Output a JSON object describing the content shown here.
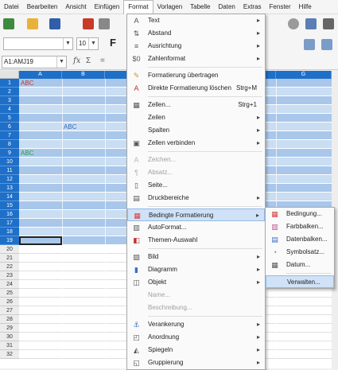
{
  "menubar": [
    "Datei",
    "Bearbeiten",
    "Ansicht",
    "Einfügen",
    "Format",
    "Vorlagen",
    "Tabelle",
    "Daten",
    "Extras",
    "Fenster",
    "Hilfe"
  ],
  "toolbar": {
    "font_size": "10",
    "name_box": "A1:AMJ19",
    "fx": "fx",
    "sigma": "Σ",
    "equals": "=",
    "big_f": "F"
  },
  "columns": [
    "A",
    "B",
    "G"
  ],
  "cells": {
    "a1": "ABC",
    "b6": "ABC",
    "a9": "ABC"
  },
  "rows": [
    "1",
    "2",
    "3",
    "4",
    "5",
    "6",
    "7",
    "8",
    "9",
    "10",
    "11",
    "12",
    "13",
    "14",
    "15",
    "16",
    "17",
    "18",
    "19",
    "20",
    "21",
    "22",
    "23",
    "24",
    "25",
    "26",
    "27",
    "28",
    "29",
    "30",
    "31",
    "32"
  ],
  "format_menu": [
    {
      "label": "Text",
      "icon": "text-icon",
      "sub": true
    },
    {
      "label": "Abstand",
      "icon": "spacing-icon",
      "sub": true
    },
    {
      "label": "Ausrichtung",
      "icon": "align-icon",
      "sub": true
    },
    {
      "label": "Zahlenformat",
      "icon": "number-format-icon",
      "sub": true
    },
    {
      "sep": true
    },
    {
      "label": "Formatierung übertragen",
      "icon": "paintbrush-icon"
    },
    {
      "label": "Direkte Formatierung löschen",
      "icon": "clear-format-icon",
      "shortcut": "Strg+M"
    },
    {
      "sep": true
    },
    {
      "label": "Zellen...",
      "icon": "cells-icon",
      "shortcut": "Strg+1"
    },
    {
      "label": "Zeilen",
      "sub": true
    },
    {
      "label": "Spalten",
      "sub": true
    },
    {
      "label": "Zellen verbinden",
      "icon": "merge-icon",
      "sub": true
    },
    {
      "sep": true
    },
    {
      "label": "Zeichen...",
      "icon": "character-icon",
      "disabled": true
    },
    {
      "label": "Absatz...",
      "icon": "paragraph-icon",
      "disabled": true
    },
    {
      "label": "Seite...",
      "icon": "page-icon"
    },
    {
      "label": "Druckbereiche",
      "icon": "print-range-icon",
      "sub": true
    },
    {
      "sep": true
    },
    {
      "label": "Bedingte Formatierung",
      "icon": "conditional-format-icon",
      "sub": true,
      "highlighted": true
    },
    {
      "label": "AutoFormat...",
      "icon": "autoformat-icon"
    },
    {
      "label": "Themen-Auswahl",
      "icon": "theme-icon"
    },
    {
      "sep": true
    },
    {
      "label": "Bild",
      "icon": "image-icon",
      "sub": true
    },
    {
      "label": "Diagramm",
      "icon": "chart-icon",
      "sub": true
    },
    {
      "label": "Objekt",
      "icon": "object-icon",
      "sub": true
    },
    {
      "label": "Name...",
      "disabled": true
    },
    {
      "label": "Beschreibung...",
      "disabled": true
    },
    {
      "sep": true
    },
    {
      "label": "Verankerung",
      "icon": "anchor-icon",
      "sub": true
    },
    {
      "label": "Anordnung",
      "icon": "arrange-icon",
      "sub": true
    },
    {
      "label": "Spiegeln",
      "icon": "flip-icon",
      "sub": true
    },
    {
      "label": "Gruppierung",
      "icon": "group-icon",
      "sub": true
    }
  ],
  "cond_submenu": [
    {
      "label": "Bedingung...",
      "icon": "condition-icon"
    },
    {
      "label": "Farbbalken...",
      "icon": "color-scale-icon"
    },
    {
      "label": "Datenbalken...",
      "icon": "data-bar-icon"
    },
    {
      "label": "Symbolsatz...",
      "icon": "icon-set-icon"
    },
    {
      "label": "Datum...",
      "icon": "date-icon"
    },
    {
      "sep": true
    },
    {
      "label": "Verwalten...",
      "highlighted": true
    }
  ],
  "colors": {
    "selection_header": "#1e6fc8",
    "row_odd": "#a9c7ea",
    "row_even": "#c9ddf3",
    "highlight": "#cfe2f7"
  }
}
